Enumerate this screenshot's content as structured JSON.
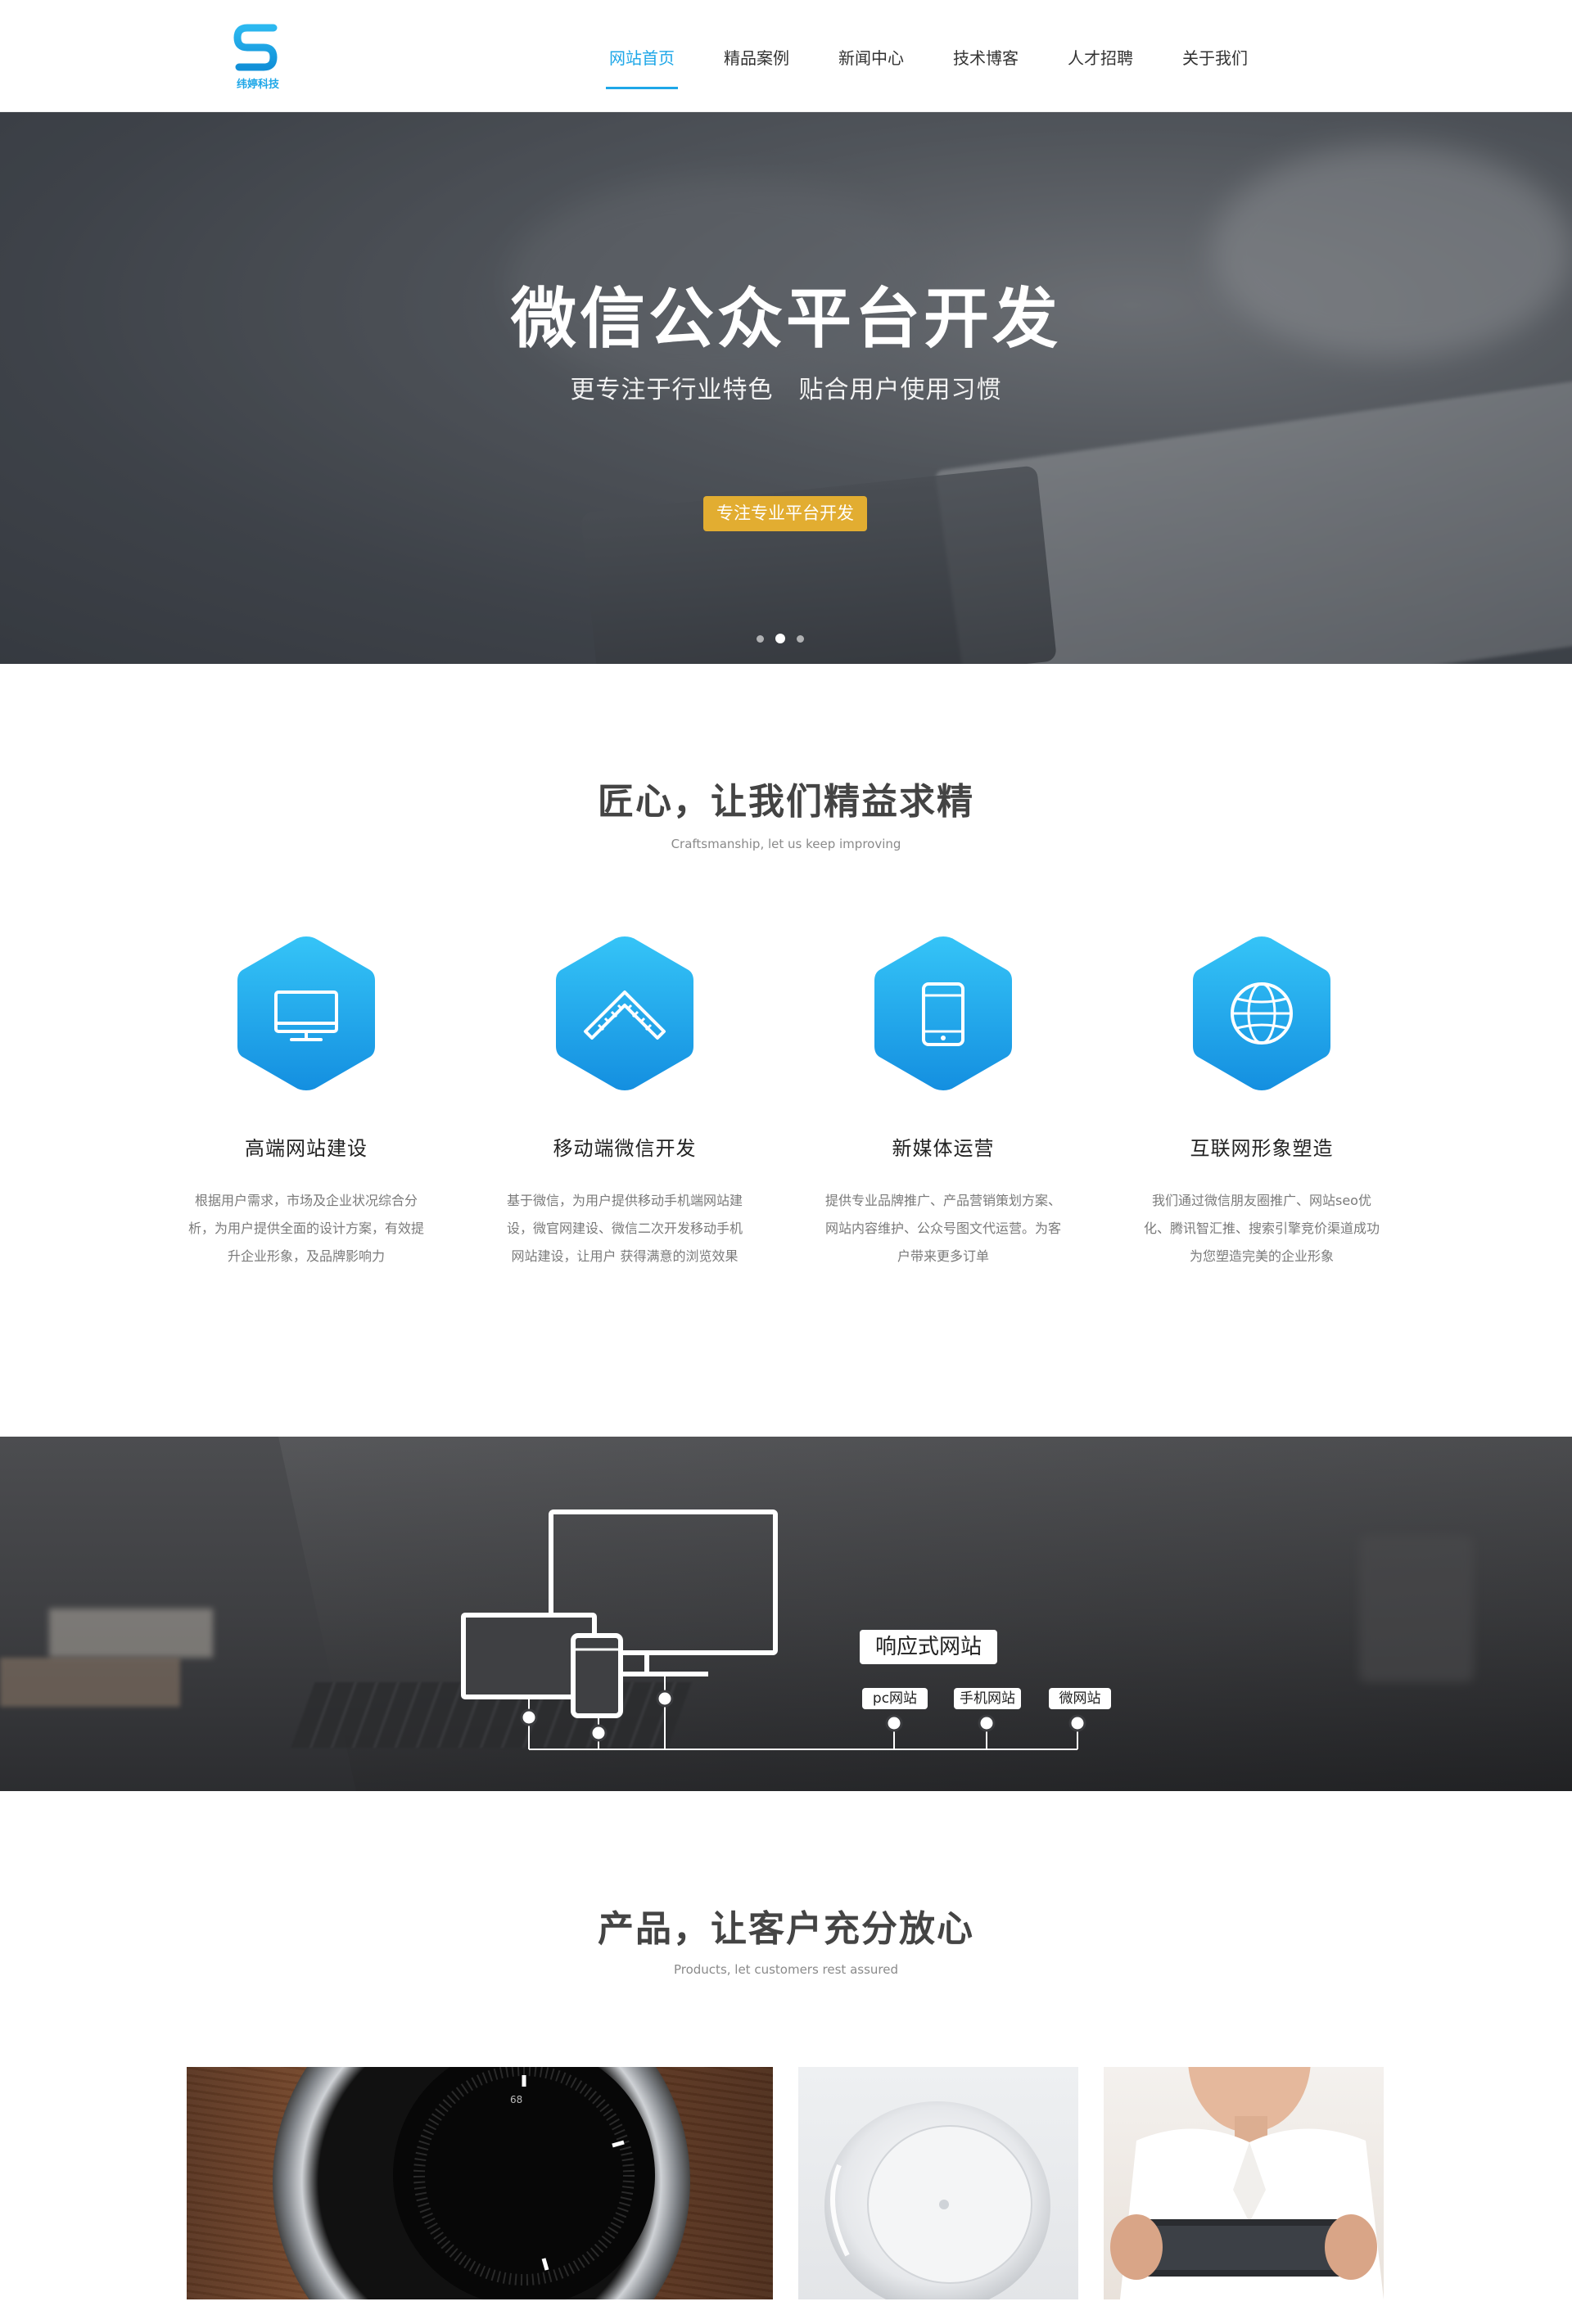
{
  "header": {
    "logo_text": "纬婷科技",
    "nav": [
      {
        "label": "网站首页",
        "active": true
      },
      {
        "label": "精品案例",
        "active": false
      },
      {
        "label": "新闻中心",
        "active": false
      },
      {
        "label": "技术博客",
        "active": false
      },
      {
        "label": "人才招聘",
        "active": false
      },
      {
        "label": "关于我们",
        "active": false
      }
    ]
  },
  "hero": {
    "title": "微信公众平台开发",
    "subtitle": "更专注于行业特色　贴合用户使用习惯",
    "button_label": "专注专业平台开发",
    "slides_total": 3,
    "active_slide": 2
  },
  "craft": {
    "title": "匠心，让我们精益求精",
    "subtitle": "Craftsmanship, let us keep improving"
  },
  "services": [
    {
      "icon": "monitor-icon",
      "title": "高端网站建设",
      "desc": "根据用户需求，市场及企业状况综合分析，为用户提供全面的设计方案，有效提升企业形象，及品牌影响力"
    },
    {
      "icon": "ruler-icon",
      "title": "移动端微信开发",
      "desc": "基于微信，为用户提供移动手机端网站建设，微官网建设、微信二次开发移动手机网站建设，让用户 获得满意的浏览效果"
    },
    {
      "icon": "mobile-icon",
      "title": "新媒体运营",
      "desc": "提供专业品牌推广、产品营销策划方案、网站内容维护、公众号图文代运营。为客户带来更多订单"
    },
    {
      "icon": "globe-icon",
      "title": "互联网形象塑造",
      "desc": "我们通过微信朋友圈推广、网站seo优化、腾讯智汇推、搜索引擎竞价渠道成功为您塑造完美的企业形象"
    }
  ],
  "responsive": {
    "title": "响应式网站",
    "items": [
      "pc网站",
      "手机网站",
      "微网站"
    ]
  },
  "products": {
    "title": "产品，让客户充分放心",
    "subtitle": "Products, let customers rest assured",
    "items": [
      {
        "name": "knob-product-image",
        "dial_number": "68"
      },
      {
        "name": "speaker-product-image"
      },
      {
        "name": "phone-game-product-image"
      }
    ]
  },
  "colors": {
    "accent": "#1ea7e8",
    "hero_button": "#e2ad31",
    "text_dark": "#222222",
    "text_muted": "#7a7a7a"
  }
}
